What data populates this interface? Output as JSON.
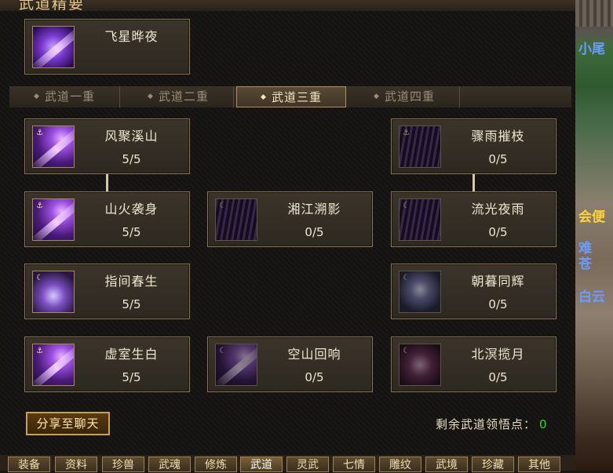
{
  "panel": {
    "title": "武道精要"
  },
  "top_skill": {
    "name": "飞星晔夜"
  },
  "tabs": [
    {
      "label": "武道一重",
      "active": false
    },
    {
      "label": "武道二重",
      "active": false
    },
    {
      "label": "武道三重",
      "active": true
    },
    {
      "label": "武道四重",
      "active": false
    }
  ],
  "skills": [
    {
      "name": "风聚溪山",
      "level": "5/5"
    },
    {
      "name": "骤雨摧枝",
      "level": "0/5"
    },
    {
      "name": "山火袭身",
      "level": "5/5"
    },
    {
      "name": "湘江溯影",
      "level": "0/5"
    },
    {
      "name": "流光夜雨",
      "level": "0/5"
    },
    {
      "name": "指间春生",
      "level": "5/5"
    },
    {
      "name": "朝暮同辉",
      "level": "0/5"
    },
    {
      "name": "虚室生白",
      "level": "5/5"
    },
    {
      "name": "空山回响",
      "level": "0/5"
    },
    {
      "name": "北溟揽月",
      "level": "0/5"
    }
  ],
  "footer": {
    "share_label": "分享至聊天",
    "points_label": "剩余武道领悟点：",
    "points_value": "0"
  },
  "bottom_tabs": [
    "装备",
    "资料",
    "珍兽",
    "武魂",
    "修炼",
    "武道",
    "灵武",
    "七情",
    "雕纹",
    "武境",
    "珍藏",
    "其他"
  ],
  "scene_text": [
    "小尾",
    "会便",
    "难",
    "苍",
    "白云"
  ],
  "colors": {
    "accent": "#e8c98a",
    "points_value": "#28e028",
    "border": "#8a7650"
  }
}
